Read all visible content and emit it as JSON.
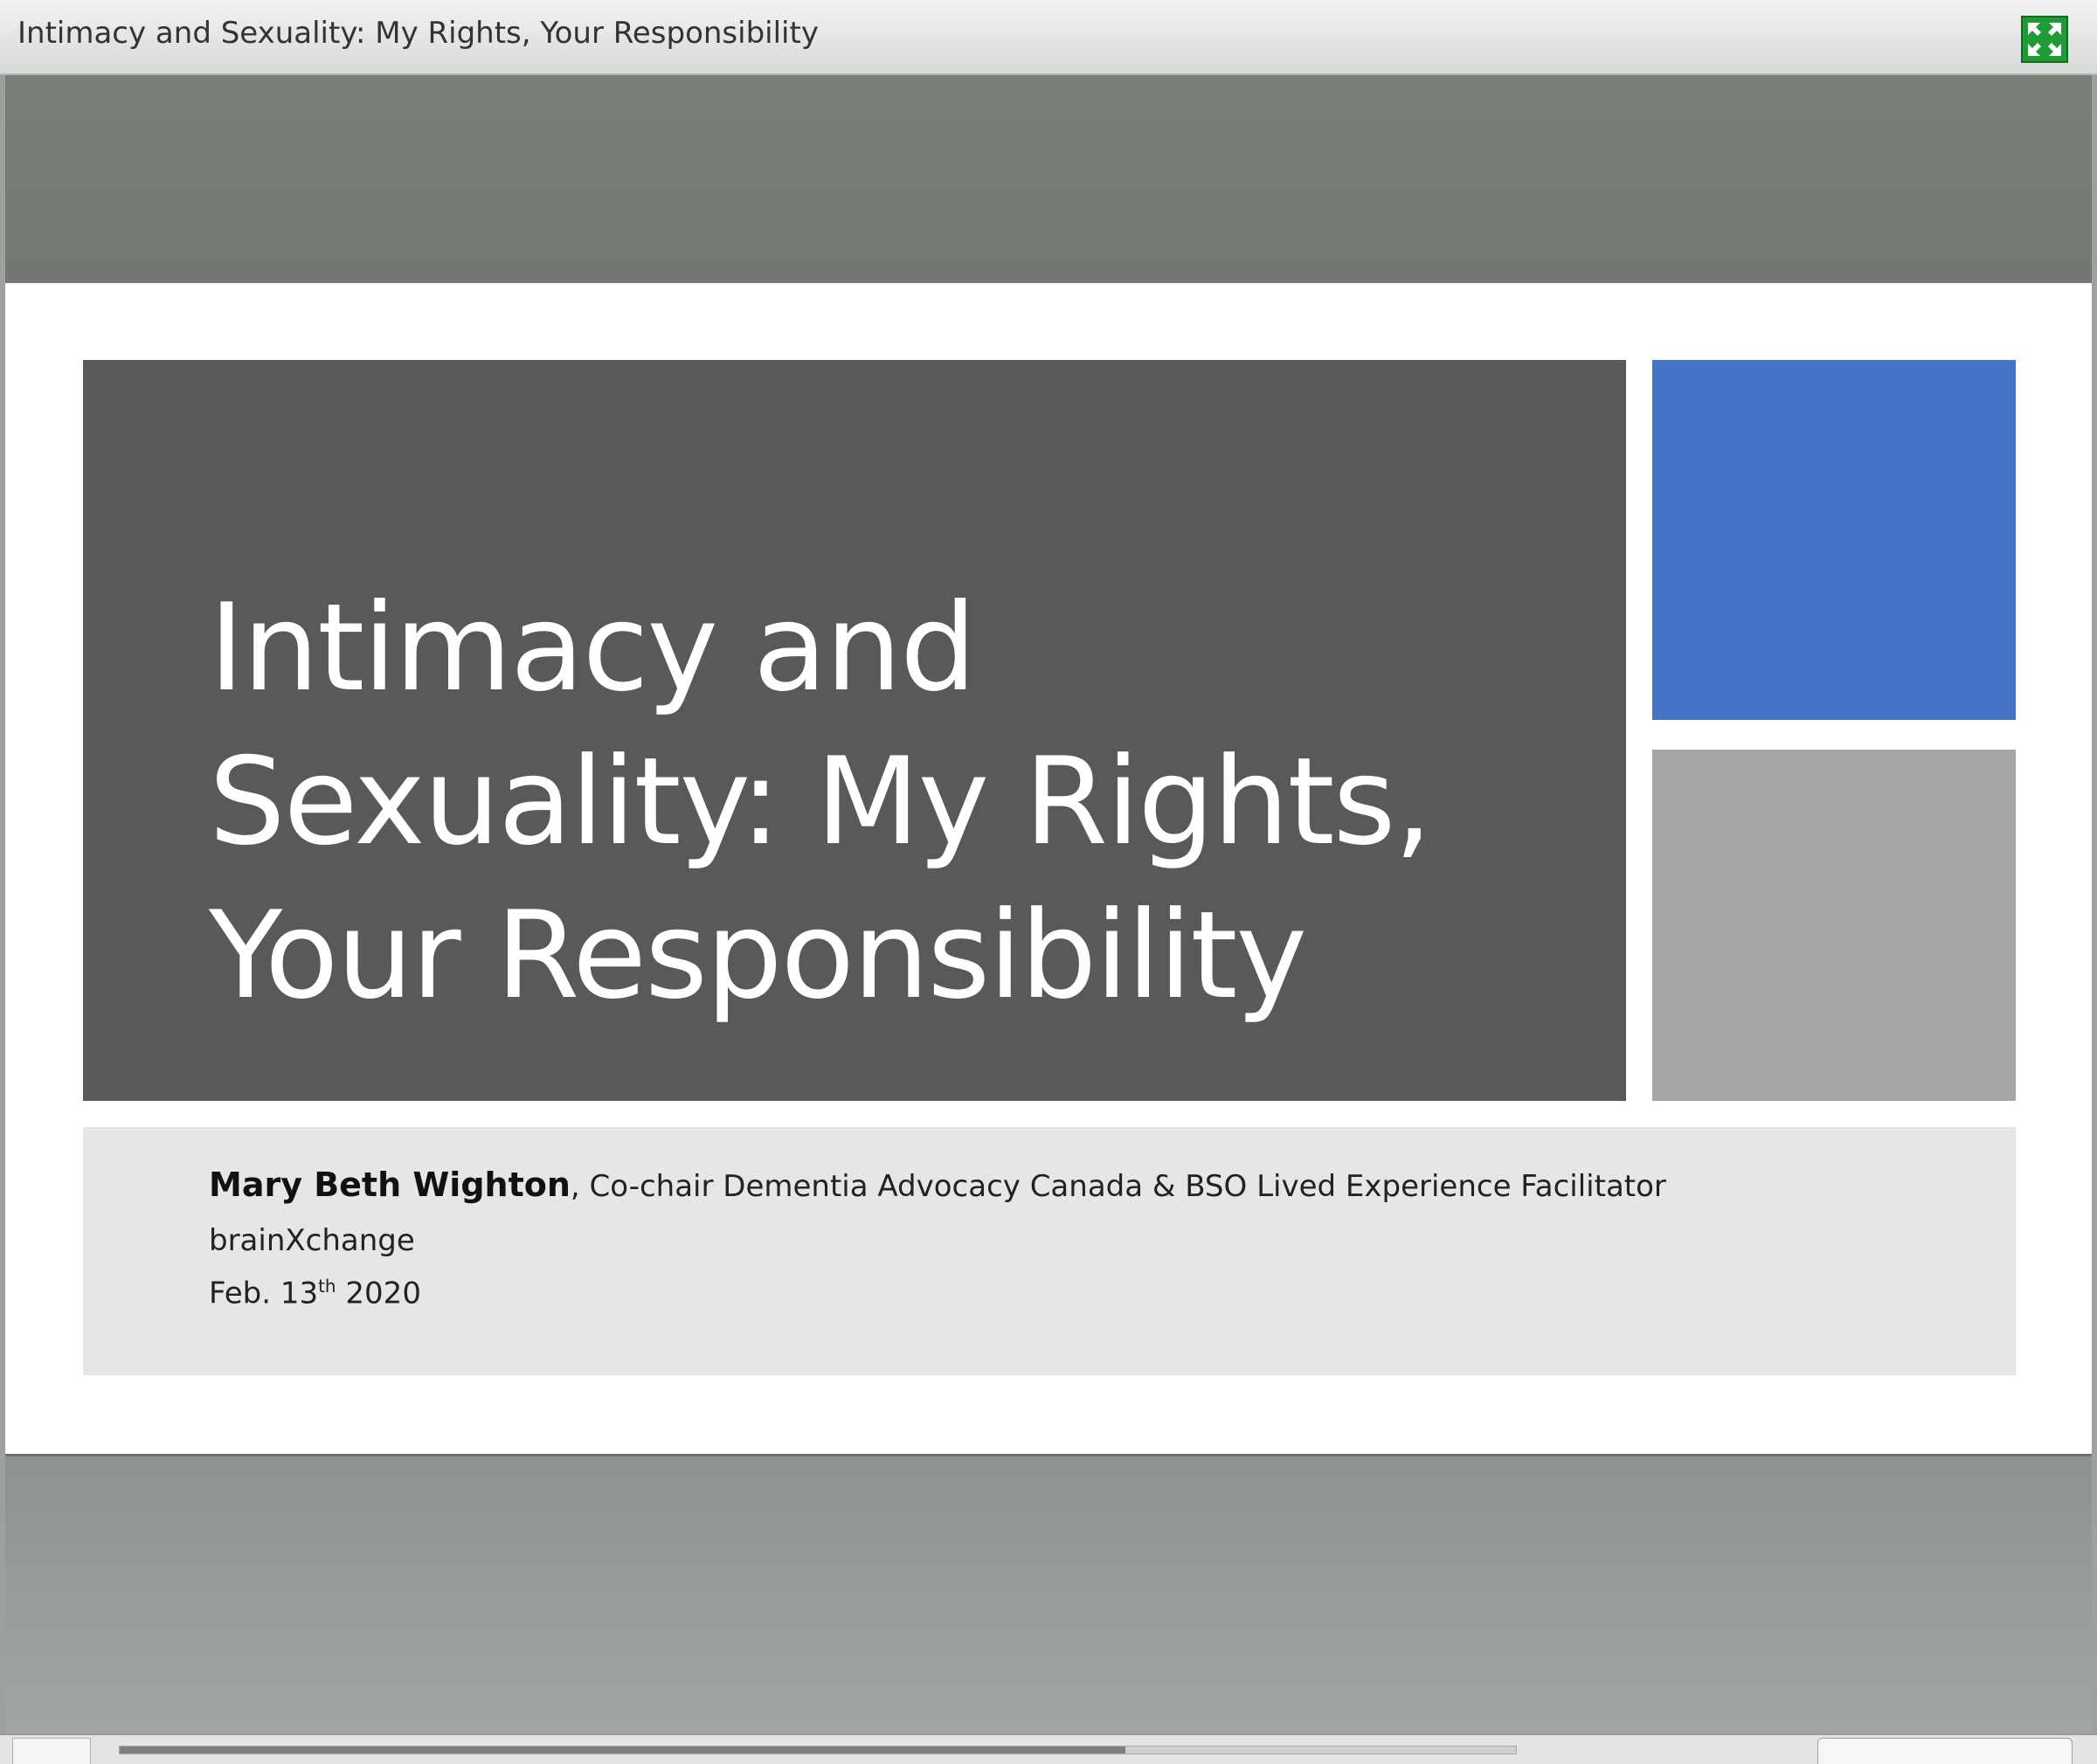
{
  "window": {
    "title": "Intimacy and Sexuality: My Rights, Your Responsibility",
    "expand_icon": "expand-arrows-icon",
    "expand_color": "#1f9a36"
  },
  "slide": {
    "title": "Intimacy and\nSexuality: My Rights,\nYour Responsibility",
    "presenter_name": "Mary Beth Wighton",
    "presenter_role": ", Co-chair Dementia Advocacy Canada & BSO Lived Experience Facilitator",
    "organization": "brainXchange",
    "date_prefix": "Feb. 13",
    "date_suffix": "th",
    "date_year": " 2020",
    "colors": {
      "title_box": "#595959",
      "accent_blue": "#4472c4",
      "accent_gray": "#a6a6a6",
      "subtitle_box": "#e6e6e6"
    }
  },
  "player": {
    "progress": 0.72
  }
}
